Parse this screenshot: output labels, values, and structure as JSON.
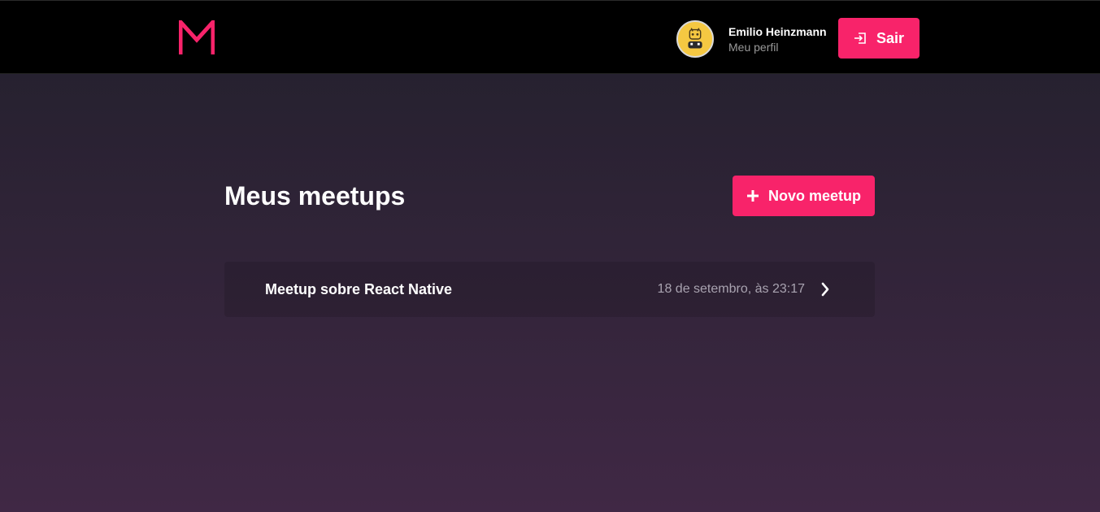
{
  "header": {
    "logo_icon": "meetapp-logo-icon",
    "brand_color": "#f8236a",
    "user": {
      "name": "Emilio Heinzmann",
      "profile_link": "Meu perfil",
      "avatar_icon": "avatar-face-icon"
    },
    "logout": {
      "label": "Sair",
      "icon": "logout-icon"
    }
  },
  "main": {
    "title": "Meus meetups",
    "new_button": {
      "label": "Novo meetup",
      "icon": "plus-icon"
    },
    "meetups": [
      {
        "title": "Meetup sobre React Native",
        "date": "18 de setembro, às 23:17",
        "icon": "chevron-right-icon"
      }
    ]
  }
}
